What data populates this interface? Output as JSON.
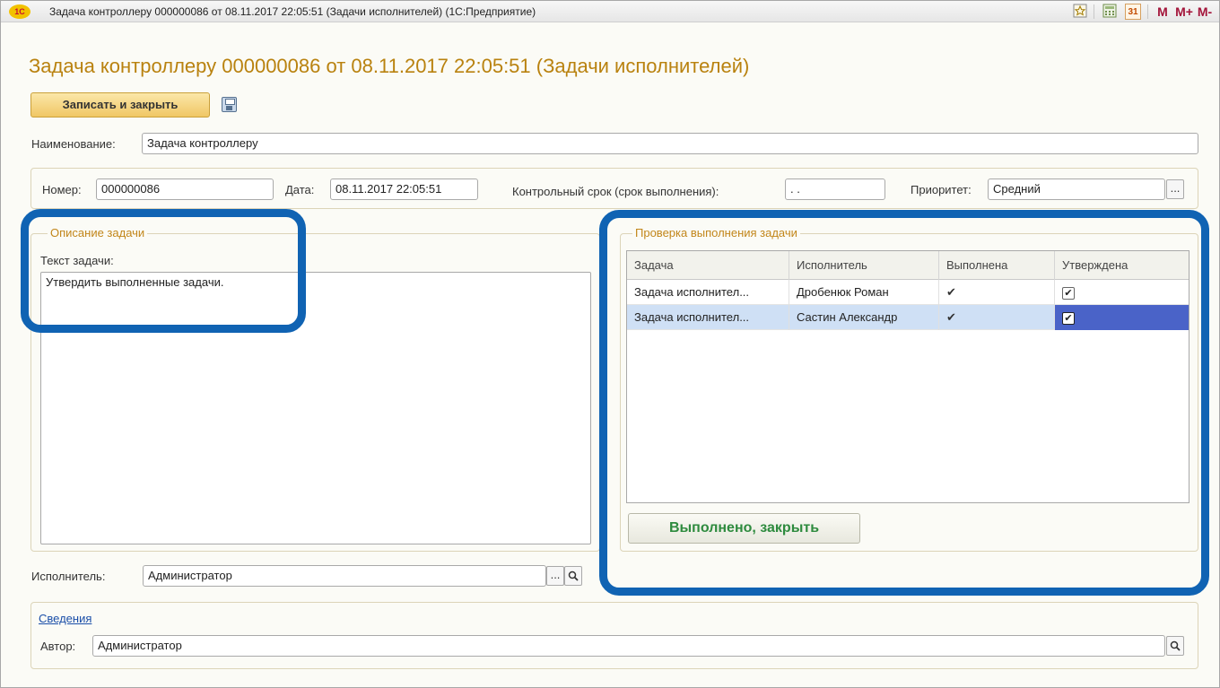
{
  "window": {
    "title": "Задача контроллеру 000000086 от 08.11.2017 22:05:51 (Задачи исполнителей)  (1С:Предприятие)",
    "app_icon_text": "1С",
    "toolbar_buttons": [
      "M",
      "M+",
      "M-"
    ],
    "close_symbol": "✕",
    "maximize_symbol": "☐",
    "calendar_text": "31"
  },
  "form": {
    "heading": "Задача контроллеру 000000086 от 08.11.2017 22:05:51 (Задачи исполнителей)",
    "save_close_label": "Записать и закрыть",
    "name_label": "Наименование:",
    "name_value": "Задача контроллеру",
    "number_label": "Номер:",
    "number_value": "000000086",
    "date_label": "Дата:",
    "date_value": "08.11.2017 22:05:51",
    "deadline_label": "Контрольный срок (срок выполнения):",
    "deadline_value": " .  .",
    "priority_label": "Приоритет:",
    "priority_value": "Средний",
    "pick_dots": "...",
    "description_group_title": "Описание задачи",
    "task_text_label": "Текст задачи:",
    "task_text_value": "Утвердить выполненные задачи.",
    "check_group_title": "Проверка выполнения задачи",
    "done_button_label": "Выполнено, закрыть",
    "executor_label": "Исполнитель:",
    "executor_value": "Администратор",
    "info_link": "Сведения",
    "author_label": "Автор:",
    "author_value": "Администратор"
  },
  "table": {
    "columns": [
      "Задача",
      "Исполнитель",
      "Выполнена",
      "Утверждена"
    ],
    "rows": [
      {
        "task": "Задача исполнител...",
        "executor": "Дробенюк Роман",
        "done": "✔",
        "approved": "✔",
        "selected": false
      },
      {
        "task": "Задача исполнител...",
        "executor": "Састин Александр",
        "done": "✔",
        "approved": "✔",
        "selected": true
      }
    ]
  },
  "colors": {
    "heading": "#b9820f",
    "callout": "#1063b3",
    "done_button_text": "#2e8b3e",
    "selected_row": "#cfe0f5"
  }
}
